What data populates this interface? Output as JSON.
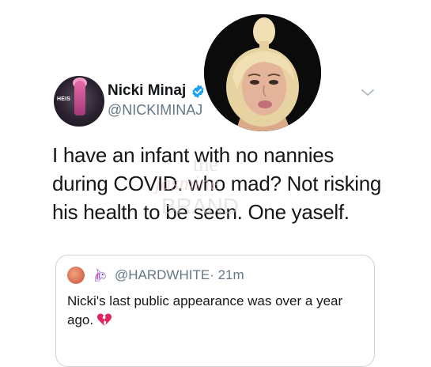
{
  "tweet": {
    "display_name": "Nicki Minaj",
    "handle": "@NICKIMINAJ",
    "avatar_badge_text": "HEIS",
    "text": "I have an infant with no nannies during COVID. who mad? Not risking his health to be seen. One yaself."
  },
  "watermark": {
    "line1": "the",
    "line2": "jasmine",
    "line3": "BRAND"
  },
  "quoted_tweet": {
    "handle": "@HARDWHITE",
    "time": "· 21m",
    "text": "Nicki's last public appearance was over a year ago."
  },
  "colors": {
    "text": "#14171a",
    "secondary": "#657786",
    "border": "#ccd6dd",
    "verified": "#1da1f2",
    "broken_heart": "#e0245e"
  },
  "icons": [
    "verified-badge-icon",
    "chevron-down-icon",
    "unicorn-icon",
    "broken-heart-icon"
  ]
}
